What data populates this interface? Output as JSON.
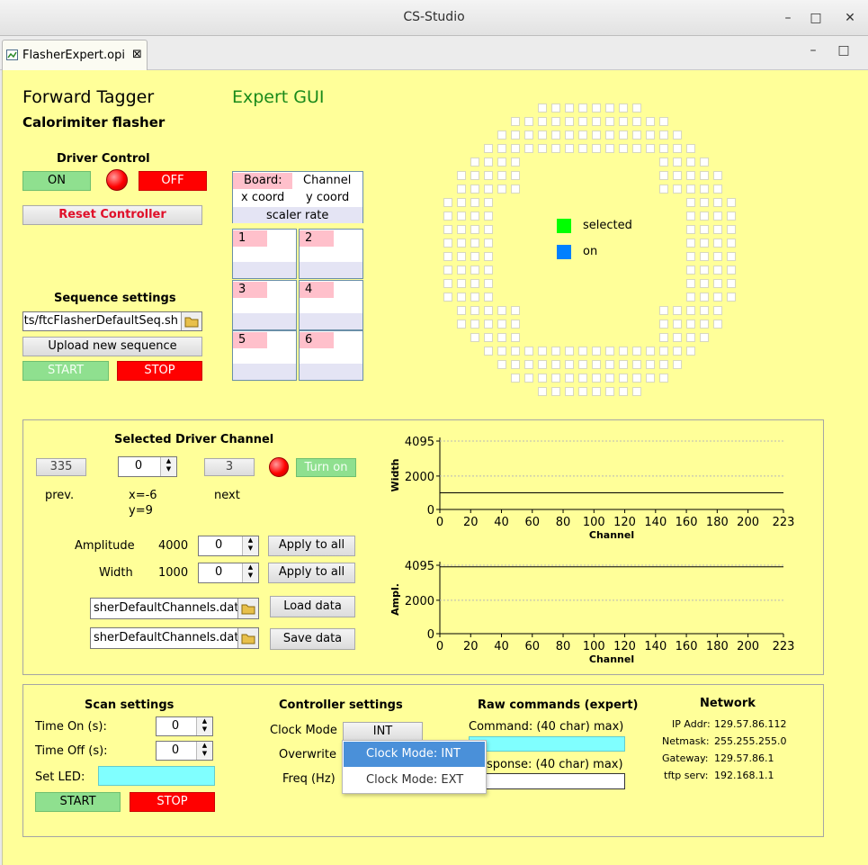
{
  "window": {
    "title": "CS-Studio"
  },
  "tab": {
    "label": "FlasherExpert.opi",
    "close": "⊠"
  },
  "header": {
    "title": "Forward Tagger",
    "subtitle": "Calorimiter flasher",
    "expert": "Expert GUI"
  },
  "driver_control": {
    "title": "Driver Control",
    "on": "ON",
    "off": "OFF",
    "reset": "Reset Controller"
  },
  "sequence": {
    "title": "Sequence settings",
    "file": "ts/ftcFlasherDefaultSeq.sh",
    "upload": "Upload new sequence",
    "start": "START",
    "stop": "STOP"
  },
  "board_info": {
    "board": "Board:",
    "channel": "Channel",
    "xcoord": "x coord",
    "ycoord": "y coord",
    "scaler": "scaler rate"
  },
  "boards": [
    "1",
    "2",
    "3",
    "4",
    "5",
    "6"
  ],
  "legend": {
    "selected": "selected",
    "on": "on",
    "selected_color": "#00ff00",
    "on_color": "#0080ff"
  },
  "channel_panel": {
    "title": "Selected Driver Channel",
    "prev_value": "335",
    "current": "0",
    "next_value": "3",
    "prev_label": "prev.",
    "next_label": "next",
    "x": "x=-6",
    "y": "y=9",
    "turn_on": "Turn on",
    "amplitude_label": "Amplitude",
    "amplitude_value": "4000",
    "amplitude_set": "0",
    "width_label": "Width",
    "width_value": "1000",
    "width_set": "0",
    "apply_all": "Apply to all",
    "file1": "sherDefaultChannels.dat",
    "file2": "sherDefaultChannels.dat",
    "load": "Load data",
    "save": "Save data"
  },
  "chart_data": [
    {
      "type": "line",
      "xlabel": "Channel",
      "ylabel": "Width",
      "xlim": [
        0,
        223
      ],
      "ylim": [
        0,
        4095
      ],
      "yticks": [
        "4095",
        "2000",
        "0"
      ],
      "xticks": [
        "0",
        "20",
        "40",
        "60",
        "80",
        "100",
        "120",
        "140",
        "160",
        "180",
        "200",
        "223"
      ],
      "series": [
        {
          "x": [
            0,
            223
          ],
          "y": [
            1000,
            1000
          ]
        }
      ]
    },
    {
      "type": "line",
      "xlabel": "Channel",
      "ylabel": "Ampl.",
      "xlim": [
        0,
        223
      ],
      "ylim": [
        0,
        4095
      ],
      "yticks": [
        "4095",
        "2000",
        "0"
      ],
      "xticks": [
        "0",
        "20",
        "40",
        "60",
        "80",
        "100",
        "120",
        "140",
        "160",
        "180",
        "200",
        "223"
      ],
      "series": [
        {
          "x": [
            0,
            223
          ],
          "y": [
            4000,
            4000
          ]
        }
      ]
    }
  ],
  "scan": {
    "title": "Scan settings",
    "time_on": "Time On (s):",
    "time_off": "Time Off (s):",
    "set_led": "Set LED:",
    "time_on_value": "0",
    "time_off_value": "0",
    "start": "START",
    "stop": "STOP"
  },
  "controller": {
    "title": "Controller settings",
    "clock_mode": "Clock Mode",
    "overwrite": "Overwrite",
    "freq": "Freq (Hz)",
    "clock_value": "INT",
    "menu": [
      "Clock Mode: INT",
      "Clock Mode: EXT"
    ]
  },
  "raw": {
    "title": "Raw commands (expert)",
    "command": "Command: (40 char) max)",
    "response": "sponse: (40 char) max)"
  },
  "network": {
    "title": "Network",
    "ip_label": "IP Addr:",
    "ip": "129.57.86.112",
    "mask_label": "Netmask:",
    "mask": "255.255.255.0",
    "gw_label": "Gateway:",
    "gw": "129.57.86.1",
    "tftp_label": "tftp serv:",
    "tftp": "192.168.1.1"
  }
}
